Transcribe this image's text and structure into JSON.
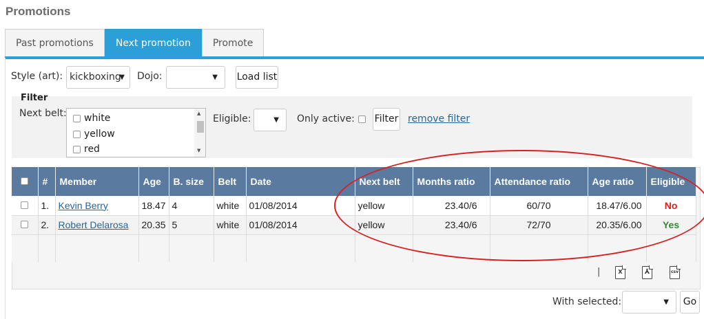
{
  "page": {
    "title": "Promotions"
  },
  "tabs": [
    {
      "label": "Past promotions",
      "active": false
    },
    {
      "label": "Next promotion",
      "active": true
    },
    {
      "label": "Promote",
      "active": false
    }
  ],
  "toolbar": {
    "style_label": "Style (art):",
    "style_value": "kickboxing",
    "dojo_label": "Dojo:",
    "dojo_value": "",
    "load_label": "Load list"
  },
  "filter": {
    "title": "Filter",
    "next_belt_label": "Next belt:",
    "belt_options": [
      "white",
      "yellow",
      "red"
    ],
    "eligible_label": "Eligible:",
    "eligible_value": "",
    "only_active_label": "Only active:",
    "filter_button": "Filter",
    "remove_filter": "remove filter"
  },
  "table": {
    "columns": [
      "#",
      "Member",
      "Age",
      "B. size",
      "Belt",
      "Date",
      "Next belt",
      "Months ratio",
      "Attendance ratio",
      "Age ratio",
      "Eligible"
    ],
    "rows": [
      {
        "num": "1.",
        "member": "Kevin Berry",
        "age": "18.47",
        "bsize": "4",
        "belt": "white",
        "date": "01/08/2014",
        "next_belt": "yellow",
        "months_ratio": "23.40/6",
        "attendance_ratio": "60/70",
        "age_ratio": "18.47/6.00",
        "eligible": "No"
      },
      {
        "num": "2.",
        "member": "Robert Delarosa",
        "age": "20.35",
        "bsize": "5",
        "belt": "white",
        "date": "01/08/2014",
        "next_belt": "yellow",
        "months_ratio": "23.40/6",
        "attendance_ratio": "72/70",
        "age_ratio": "20.35/6.00",
        "eligible": "Yes"
      }
    ]
  },
  "export": {
    "separator": "|",
    "icons": [
      "excel-icon",
      "pdf-icon",
      "csv-icon"
    ],
    "csv_text": "csv"
  },
  "bottom": {
    "with_selected_label": "With selected:",
    "with_selected_value": "",
    "go_label": "Go"
  },
  "colors": {
    "accent": "#2c9fd8",
    "header": "#5a7aa0",
    "no": "#e21a1a",
    "yes": "#2f8b2f",
    "annotation": "#d82020"
  }
}
